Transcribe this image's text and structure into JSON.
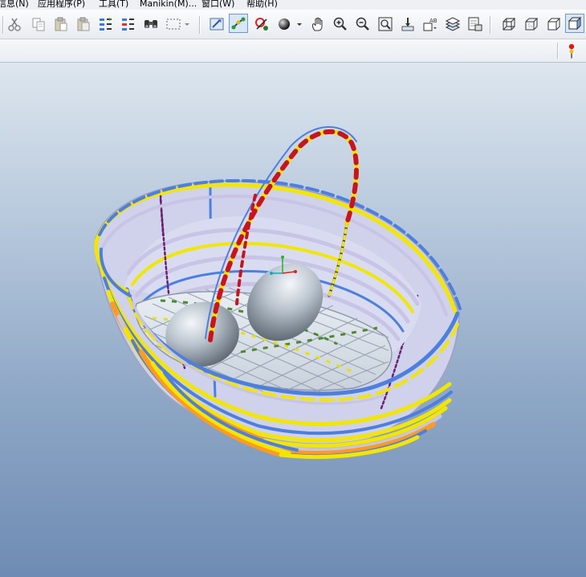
{
  "menubar": {
    "items": [
      {
        "label": "信息(N)"
      },
      {
        "label": "应用程序(P)"
      },
      {
        "label": "工具(T)"
      },
      {
        "label": "Manikin(M)..."
      },
      {
        "label": "窗口(W)"
      },
      {
        "label": "帮助(H)"
      }
    ]
  },
  "toolbar": {
    "icons": [
      "cut-icon",
      "copy-icon",
      "paste-icon",
      "paste-special-icon",
      "regenerate-icon",
      "regenerate-manager-icon",
      "find-icon",
      "select-box-icon",
      "repaint-icon",
      "spin-center-icon",
      "view-orient-icon",
      "appearance-icon",
      "pan-icon",
      "zoom-in-icon",
      "zoom-out-icon",
      "refit-icon",
      "reorient-icon",
      "saved-views-icon",
      "layers-icon",
      "view-manager-icon",
      "wireframe-icon",
      "hidden-line-icon",
      "no-hidden-icon",
      "shading-icon"
    ]
  },
  "statusbar": {
    "icon": "traffic-light-icon"
  },
  "viewport": {
    "model": "woven-basket-with-eggs",
    "background_top": "#dde6ee",
    "background_bottom": "#6e8bb3"
  },
  "colors": {
    "yellow": "#f2e600",
    "blue": "#4d7fe0",
    "lavender": "#c8c4e6",
    "orange": "#ff9a22",
    "red": "#c8141e",
    "purple": "#6a2070",
    "egg": "#a9b3bd"
  }
}
